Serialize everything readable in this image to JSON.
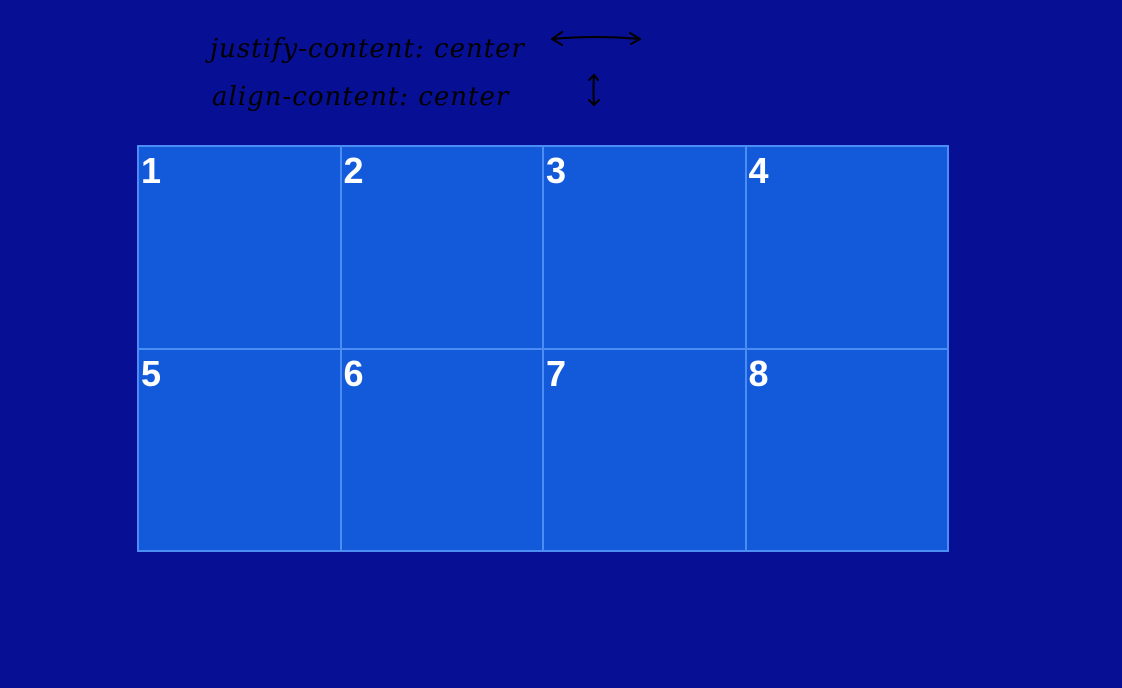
{
  "annotations": {
    "line_1": "justify-content: center",
    "line_2": "align-content: center"
  },
  "grid": {
    "cells": [
      "1",
      "2",
      "3",
      "4",
      "5",
      "6",
      "7",
      "8"
    ]
  },
  "colors": {
    "background": "#070f94",
    "cell_fill": "#125ad9",
    "cell_border": "#4b8cf5",
    "label": "#ffffff",
    "annotation_ink": "#000000"
  },
  "icons": {
    "horizontal_arrow": "double-headed-horizontal-arrow-icon",
    "vertical_arrow": "double-headed-vertical-arrow-icon"
  }
}
